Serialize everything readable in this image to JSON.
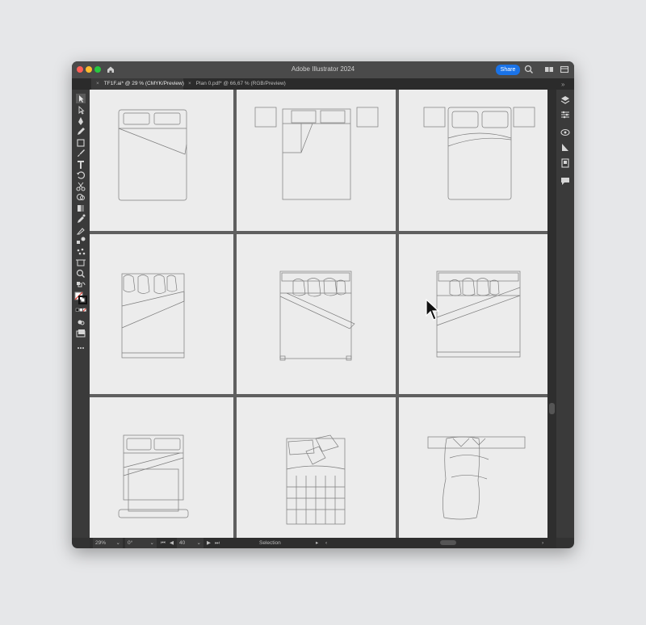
{
  "window": {
    "title": "Adobe Illustrator 2024",
    "share_label": "Share",
    "traffic_lights": {
      "close": "#ff5f57",
      "minimize": "#febc2e",
      "zoom": "#28c840"
    },
    "icons": [
      "home-icon",
      "search-icon",
      "arrange-documents-icon",
      "workspace-icon"
    ]
  },
  "tabs": [
    {
      "label": "TF1F.ai* @ 29 % (CMYK/Preview)",
      "active": true,
      "close": "×"
    },
    {
      "label": "Plan 0.pdf* @ 66,67 % (RGB/Preview)",
      "active": false,
      "close": "×"
    }
  ],
  "tools": [
    "selection-tool-icon",
    "direct-selection-tool-icon",
    "pen-tool-icon",
    "pencil-tool-icon",
    "rectangle-tool-icon",
    "paintbrush-tool-icon",
    "type-tool-icon",
    "rotate-tool-icon",
    "scissors-tool-icon",
    "shape-builder-tool-icon",
    "gradient-tool-icon",
    "eyedropper-tool-icon",
    "pipette-tool-icon",
    "blend-tool-icon",
    "symbol-sprayer-tool-icon",
    "artboard-tool-icon",
    "zoom-tool-icon",
    "swap-colors-icon",
    "fill-stroke-swatch",
    "color-mode-icons",
    "draw-mode-icon",
    "screen-mode-icon",
    "more-tools-icon"
  ],
  "panels": [
    "layers-panel-icon",
    "properties-panel-icon",
    "libraries-panel-icon",
    "appearance-panel-icon",
    "document-panel-icon",
    "comments-panel-icon"
  ],
  "status": {
    "zoom": "29%",
    "rotation": "0°",
    "artboard_number": "40",
    "tool_name": "Selection"
  },
  "colors": {
    "accent": "#1a73e8",
    "canvas": "#5f5f5f",
    "artboard": "#ececec",
    "ui_dark": "#3a3a3a"
  }
}
